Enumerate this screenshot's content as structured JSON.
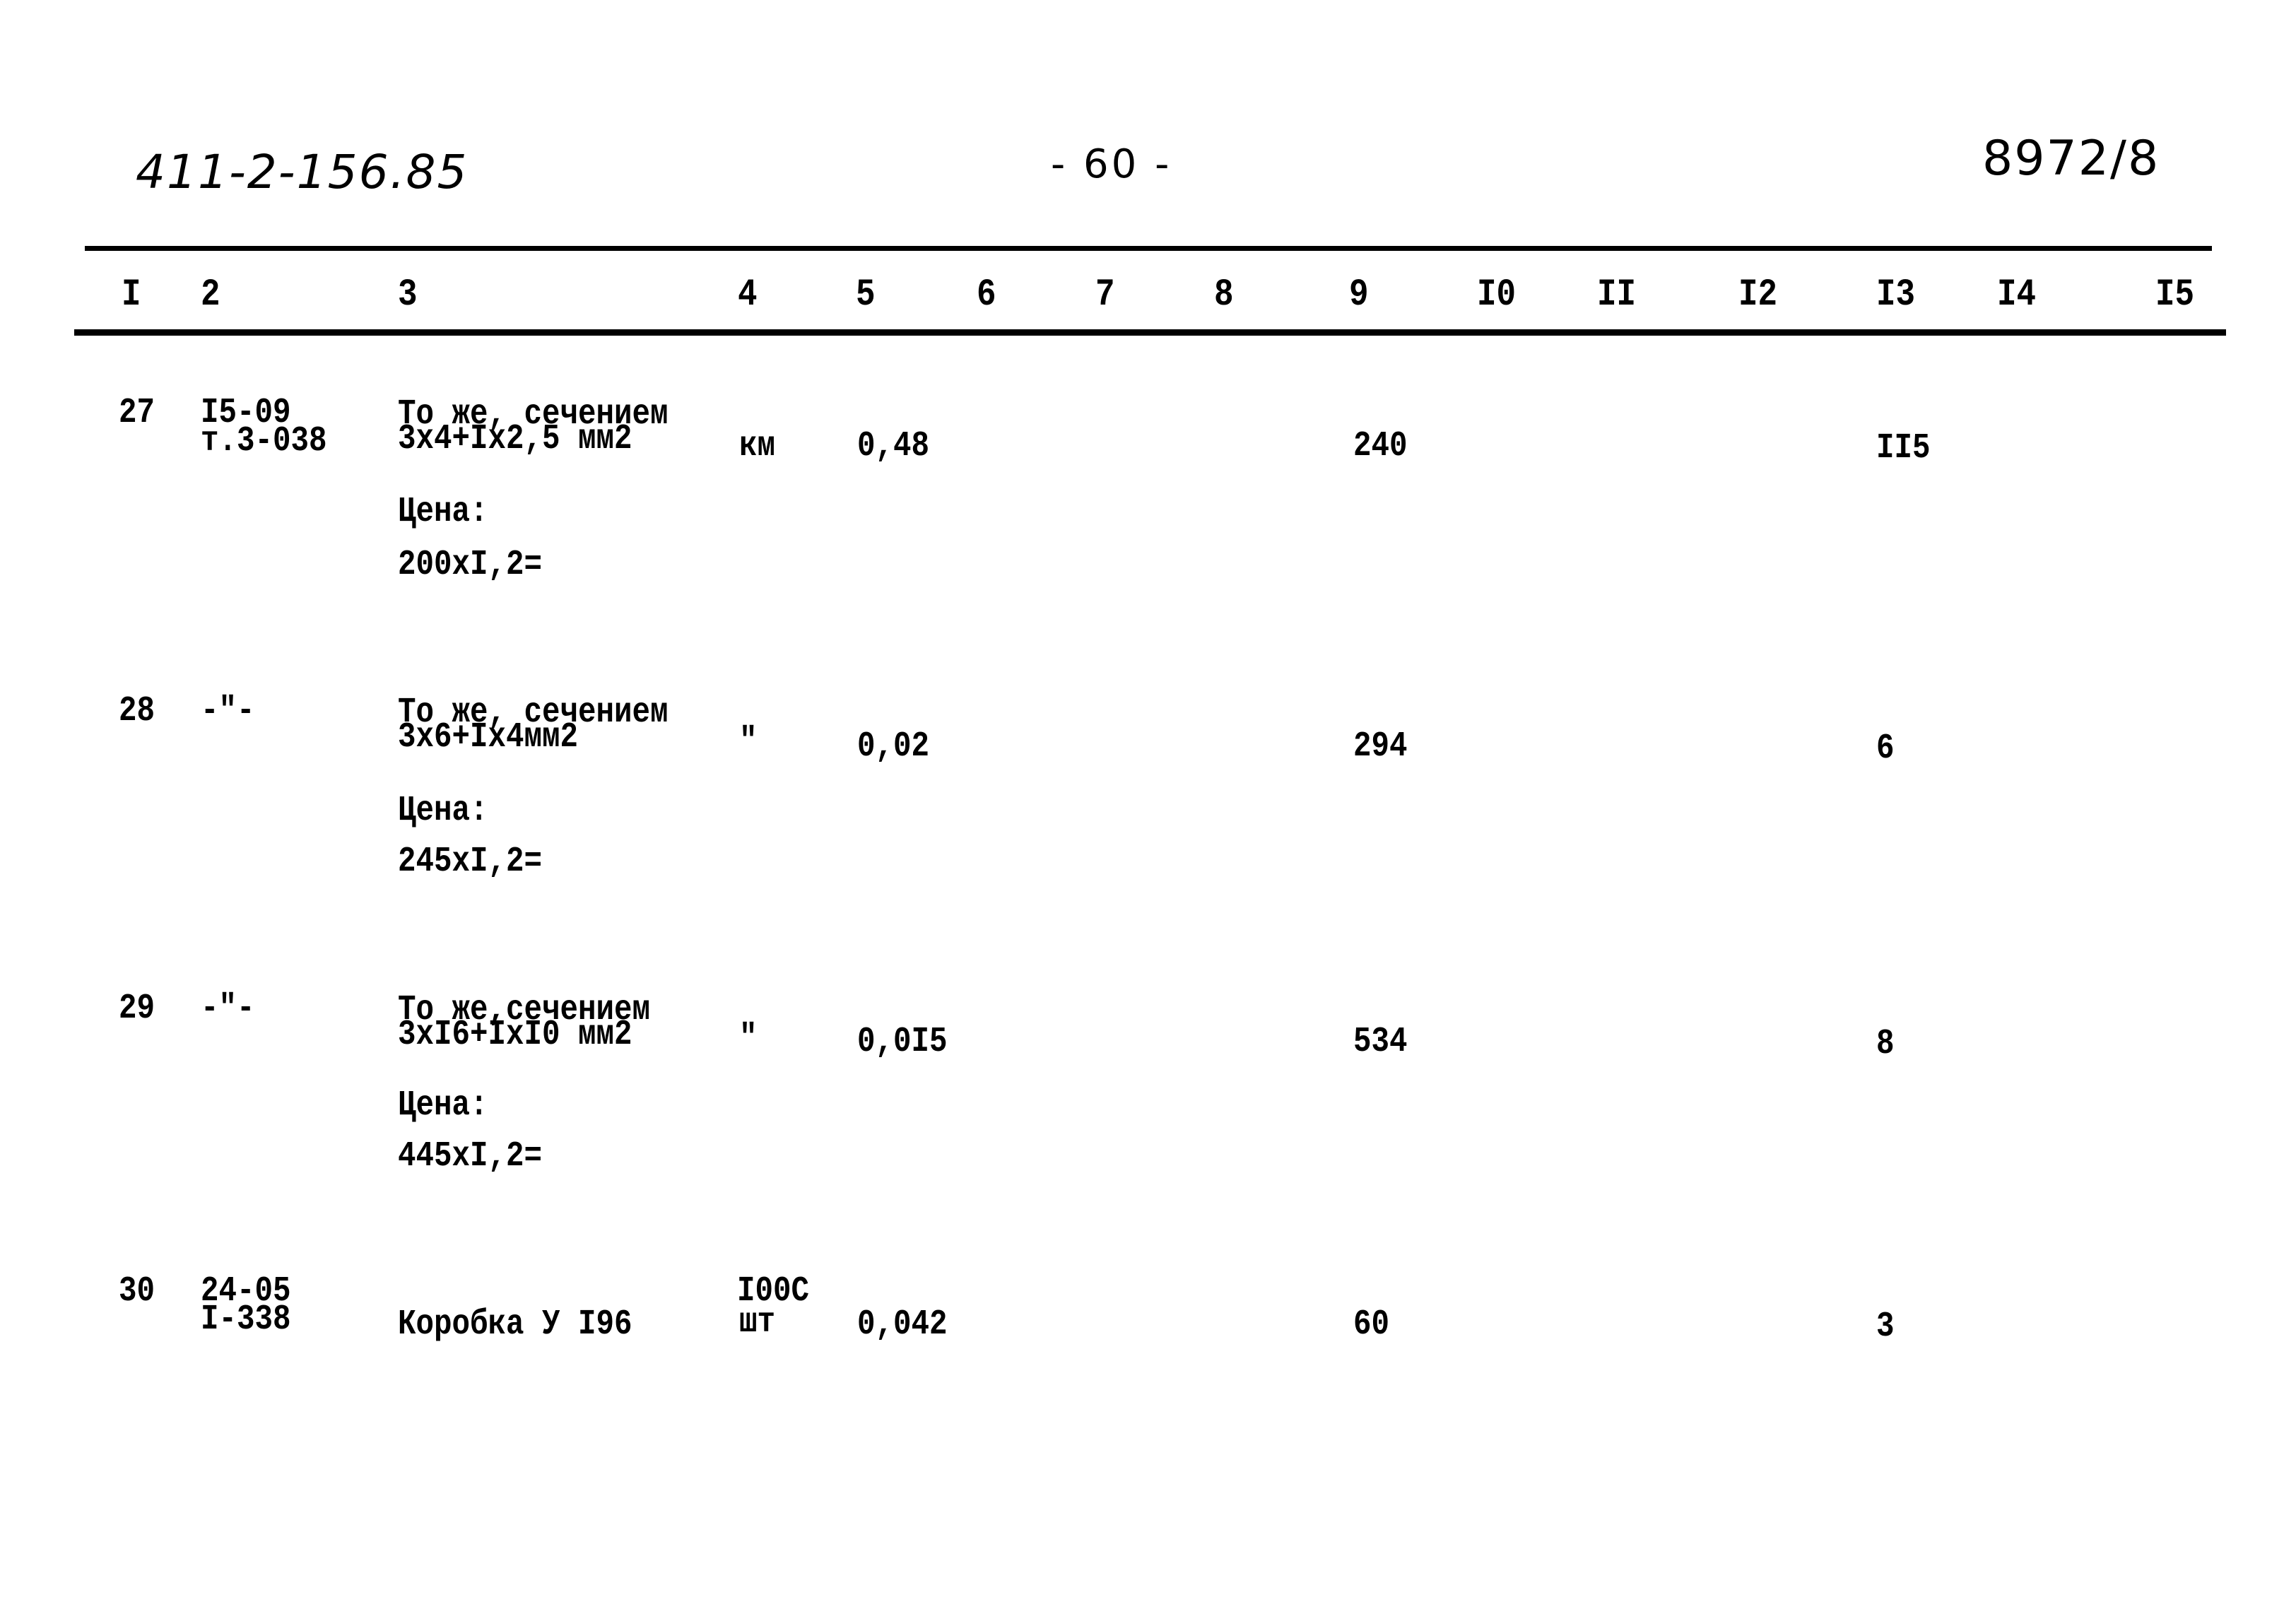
{
  "header": {
    "doc_code": "411-2-156.85",
    "page_number": "- 60 -",
    "sheet_code": "8972/8"
  },
  "table": {
    "columns": [
      "I",
      "2",
      "3",
      "4",
      "5",
      "6",
      "7",
      "8",
      "9",
      "I0",
      "II",
      "I2",
      "I3",
      "I4",
      "I5"
    ],
    "rows": [
      {
        "num": "27",
        "code_line1": "I5-09",
        "code_line2": "т.3-038",
        "desc_line1": "То же, сечением",
        "desc_line2": "3x4+Ix2,5 мм2",
        "price_label": "Цена:",
        "price_formula": "200xI,2=",
        "unit": "км",
        "qty": "0,48",
        "col9": "240",
        "col13": "II5"
      },
      {
        "num": "28",
        "code_line1": "-\"-",
        "code_line2": "",
        "desc_line1": "То же, сечением",
        "desc_line2": "3x6+Ix4мм2",
        "price_label": "Цена:",
        "price_formula": "245xI,2=",
        "unit": "\"",
        "qty": "0,02",
        "col9": "294",
        "col13": "6"
      },
      {
        "num": "29",
        "code_line1": "-\"-",
        "code_line2": "",
        "desc_line1": "То же,сечением",
        "desc_line2": "3xI6+IxI0 мм2",
        "price_label": "Цена:",
        "price_formula": "445xI,2=",
        "unit": "\"",
        "qty": "0,0I5",
        "col9": "534",
        "col13": "8"
      },
      {
        "num": "30",
        "code_line1": "24-05",
        "code_line2": "I-338",
        "desc_line1": "",
        "desc_line2": "Коробка У I96",
        "price_label": "",
        "price_formula": "",
        "unit_line1": "I00C",
        "unit": "шт",
        "qty": "0,042",
        "col9": "60",
        "col13": "3"
      }
    ]
  }
}
